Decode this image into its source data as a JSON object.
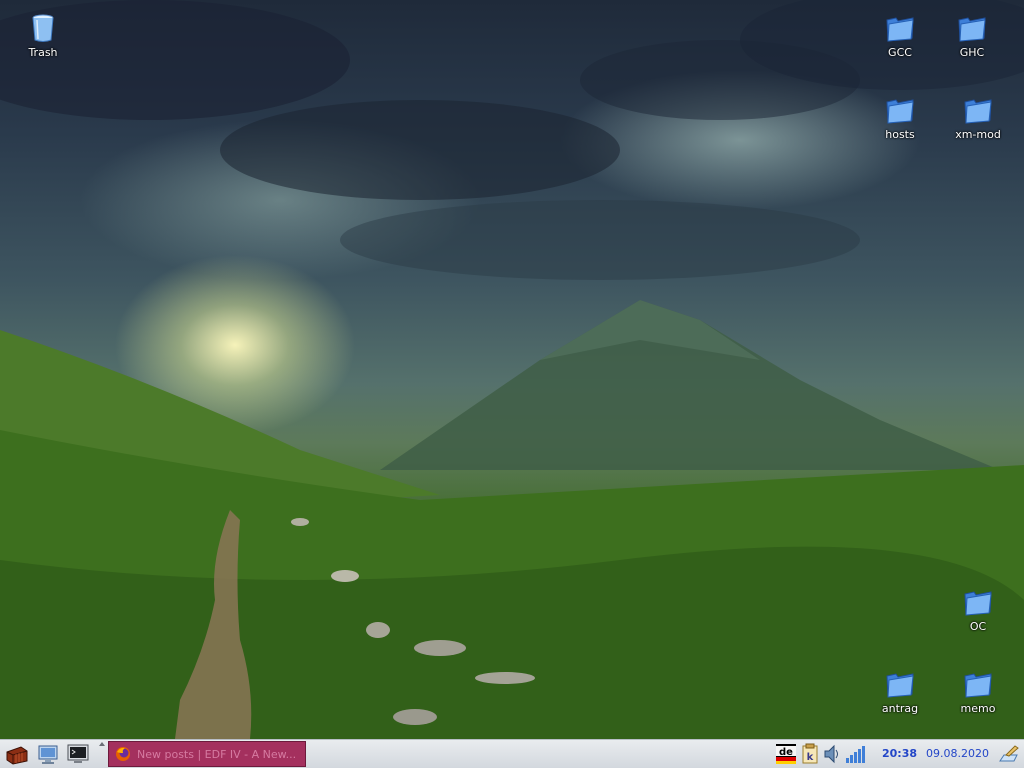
{
  "desktop": {
    "icons": [
      {
        "label": "Trash",
        "icon": "trash-icon"
      },
      {
        "label": "GCC",
        "icon": "folder-icon"
      },
      {
        "label": "GHC",
        "icon": "folder-icon"
      },
      {
        "label": "hosts",
        "icon": "folder-icon"
      },
      {
        "label": "xm-mod",
        "icon": "folder-icon"
      },
      {
        "label": "OC",
        "icon": "folder-icon"
      },
      {
        "label": "antrag",
        "icon": "folder-icon"
      },
      {
        "label": "memo",
        "icon": "folder-icon"
      }
    ]
  },
  "taskbar": {
    "launchers": [
      "start-menu-icon",
      "file-manager-icon",
      "terminal-icon"
    ],
    "tasks": [
      {
        "title": "New posts | EDF IV - A New...",
        "icon": "firefox-icon"
      }
    ],
    "tray": {
      "keyboard_layout": "de",
      "icons": [
        "keyboard-layout-icon",
        "klipper-icon",
        "volume-icon",
        "network-icon",
        "show-desktop-icon"
      ]
    },
    "clock": {
      "time": "20:38",
      "date": "09.08.2020"
    },
    "colors": {
      "task_active": "#a4305e",
      "clock_text": "#2346c8"
    }
  }
}
